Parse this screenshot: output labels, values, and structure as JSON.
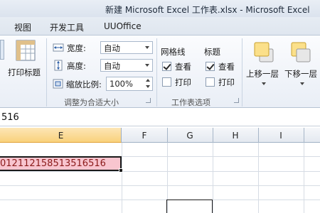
{
  "window": {
    "title": "新建 Microsoft Excel 工作表.xlsx - Microsoft Excel"
  },
  "tabs": [
    {
      "label": "视图"
    },
    {
      "label": "开发工具"
    },
    {
      "label": "UUOffice"
    }
  ],
  "ribbon": {
    "print_titles_label": "打印标题",
    "scale_group": {
      "width_label": "宽度:",
      "width_value": "自动",
      "height_label": "高度:",
      "height_value": "自动",
      "scale_label": "缩放比例:",
      "scale_value": "100%",
      "group_label": "调整为合适大小"
    },
    "sheet_options": {
      "gridlines_label": "网格线",
      "headings_label": "标题",
      "gridlines_view": {
        "label": "查看",
        "checked": true
      },
      "gridlines_print": {
        "label": "打印",
        "checked": false
      },
      "headings_view": {
        "label": "查看",
        "checked": true
      },
      "headings_print": {
        "label": "打印",
        "checked": false
      },
      "group_label": "工作表选项"
    },
    "arrange": {
      "bring_forward_label": "上移一层",
      "send_backward_label": "下移一层"
    }
  },
  "formula_bar": {
    "value": "516"
  },
  "columns": [
    "E",
    "F",
    "G",
    "H",
    "I"
  ],
  "active_cell": {
    "value": "012112158513516516"
  },
  "colors": {
    "active_fill": "#f8c5cf",
    "active_text": "#8b1a1a",
    "selected_header": "#f9d27c"
  }
}
